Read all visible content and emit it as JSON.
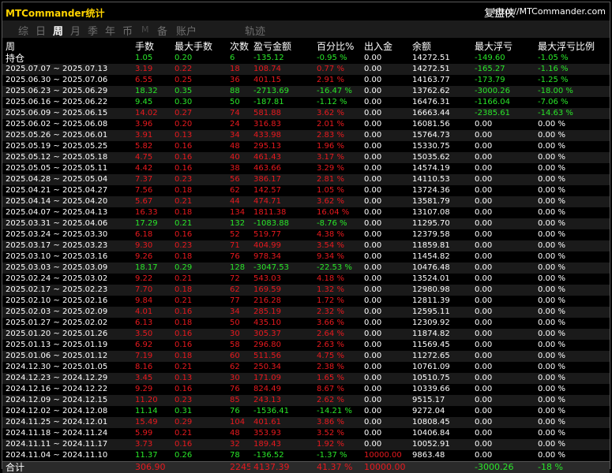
{
  "app": {
    "title": "MTCommander统计",
    "brand_cn": "复盘侠",
    "brand_url": "http://MTCommander.com"
  },
  "tabs": [
    {
      "label": "综",
      "active": false
    },
    {
      "label": "日",
      "active": false
    },
    {
      "label": "周",
      "active": true
    },
    {
      "label": "月",
      "active": false
    },
    {
      "label": "季",
      "active": false
    },
    {
      "label": "年",
      "active": false
    },
    {
      "label": "币",
      "active": false
    },
    {
      "label": "M",
      "active": false
    },
    {
      "label": "备",
      "active": false
    },
    {
      "label": "账户",
      "active": false
    },
    {
      "label": "轨迹",
      "active": false
    }
  ],
  "colors": {
    "profit": "#e8191e",
    "loss": "#29e629",
    "text": "#ffffff",
    "title": "#ffd400"
  },
  "columns": [
    "周",
    "手数",
    "最大手数",
    "次数",
    "盈亏金额",
    "百分比%",
    "出入金",
    "余额",
    "最大浮亏",
    "最大浮亏比例"
  ],
  "holding": {
    "label": "持仓",
    "lots": "1.05",
    "max_lots": "0.20",
    "count": "6",
    "pnl": "-135.12",
    "pct": "-0.95 %",
    "flow": "0.00",
    "balance": "14272.51",
    "max_float": "-149.60",
    "max_float_pct": "-1.05 %"
  },
  "rows": [
    {
      "week": "2025.07.07 ~ 2025.07.13",
      "lots": "3.19",
      "max_lots": "0.22",
      "count": "18",
      "pnl": "108.74",
      "pct": "0.77 %",
      "flow": "0.00",
      "balance": "14272.51",
      "max_float": "-165.27",
      "max_float_pct": "-1.16 %"
    },
    {
      "week": "2025.06.30 ~ 2025.07.06",
      "lots": "6.55",
      "max_lots": "0.25",
      "count": "36",
      "pnl": "401.15",
      "pct": "2.91 %",
      "flow": "0.00",
      "balance": "14163.77",
      "max_float": "-173.79",
      "max_float_pct": "-1.25 %"
    },
    {
      "week": "2025.06.23 ~ 2025.06.29",
      "lots": "18.32",
      "max_lots": "0.35",
      "count": "88",
      "pnl": "-2713.69",
      "pct": "-16.47 %",
      "flow": "0.00",
      "balance": "13762.62",
      "max_float": "-3000.26",
      "max_float_pct": "-18.00 %"
    },
    {
      "week": "2025.06.16 ~ 2025.06.22",
      "lots": "9.45",
      "max_lots": "0.30",
      "count": "50",
      "pnl": "-187.81",
      "pct": "-1.12 %",
      "flow": "0.00",
      "balance": "16476.31",
      "max_float": "-1166.04",
      "max_float_pct": "-7.06 %"
    },
    {
      "week": "2025.06.09 ~ 2025.06.15",
      "lots": "14.02",
      "max_lots": "0.27",
      "count": "74",
      "pnl": "581.88",
      "pct": "3.62 %",
      "flow": "0.00",
      "balance": "16663.44",
      "max_float": "-2385.61",
      "max_float_pct": "-14.63 %"
    },
    {
      "week": "2025.06.02 ~ 2025.06.08",
      "lots": "3.96",
      "max_lots": "0.20",
      "count": "24",
      "pnl": "316.83",
      "pct": "2.01 %",
      "flow": "0.00",
      "balance": "16081.56",
      "max_float": "0.00",
      "max_float_pct": "0.00 %"
    },
    {
      "week": "2025.05.26 ~ 2025.06.01",
      "lots": "3.91",
      "max_lots": "0.13",
      "count": "34",
      "pnl": "433.98",
      "pct": "2.83 %",
      "flow": "0.00",
      "balance": "15764.73",
      "max_float": "0.00",
      "max_float_pct": "0.00 %"
    },
    {
      "week": "2025.05.19 ~ 2025.05.25",
      "lots": "5.82",
      "max_lots": "0.16",
      "count": "48",
      "pnl": "295.13",
      "pct": "1.96 %",
      "flow": "0.00",
      "balance": "15330.75",
      "max_float": "0.00",
      "max_float_pct": "0.00 %"
    },
    {
      "week": "2025.05.12 ~ 2025.05.18",
      "lots": "4.75",
      "max_lots": "0.16",
      "count": "40",
      "pnl": "461.43",
      "pct": "3.17 %",
      "flow": "0.00",
      "balance": "15035.62",
      "max_float": "0.00",
      "max_float_pct": "0.00 %"
    },
    {
      "week": "2025.05.05 ~ 2025.05.11",
      "lots": "4.42",
      "max_lots": "0.16",
      "count": "38",
      "pnl": "463.66",
      "pct": "3.29 %",
      "flow": "0.00",
      "balance": "14574.19",
      "max_float": "0.00",
      "max_float_pct": "0.00 %"
    },
    {
      "week": "2025.04.28 ~ 2025.05.04",
      "lots": "7.37",
      "max_lots": "0.23",
      "count": "56",
      "pnl": "386.17",
      "pct": "2.81 %",
      "flow": "0.00",
      "balance": "14110.53",
      "max_float": "0.00",
      "max_float_pct": "0.00 %"
    },
    {
      "week": "2025.04.21 ~ 2025.04.27",
      "lots": "7.56",
      "max_lots": "0.18",
      "count": "62",
      "pnl": "142.57",
      "pct": "1.05 %",
      "flow": "0.00",
      "balance": "13724.36",
      "max_float": "0.00",
      "max_float_pct": "0.00 %"
    },
    {
      "week": "2025.04.14 ~ 2025.04.20",
      "lots": "5.67",
      "max_lots": "0.21",
      "count": "44",
      "pnl": "474.71",
      "pct": "3.62 %",
      "flow": "0.00",
      "balance": "13581.79",
      "max_float": "0.00",
      "max_float_pct": "0.00 %"
    },
    {
      "week": "2025.04.07 ~ 2025.04.13",
      "lots": "16.33",
      "max_lots": "0.18",
      "count": "134",
      "pnl": "1811.38",
      "pct": "16.04 %",
      "flow": "0.00",
      "balance": "13107.08",
      "max_float": "0.00",
      "max_float_pct": "0.00 %"
    },
    {
      "week": "2025.03.31 ~ 2025.04.06",
      "lots": "17.29",
      "max_lots": "0.21",
      "count": "132",
      "pnl": "-1083.88",
      "pct": "-8.76 %",
      "flow": "0.00",
      "balance": "11295.70",
      "max_float": "0.00",
      "max_float_pct": "0.00 %"
    },
    {
      "week": "2025.03.24 ~ 2025.03.30",
      "lots": "6.18",
      "max_lots": "0.16",
      "count": "52",
      "pnl": "519.77",
      "pct": "4.38 %",
      "flow": "0.00",
      "balance": "12379.58",
      "max_float": "0.00",
      "max_float_pct": "0.00 %"
    },
    {
      "week": "2025.03.17 ~ 2025.03.23",
      "lots": "9.30",
      "max_lots": "0.23",
      "count": "71",
      "pnl": "404.99",
      "pct": "3.54 %",
      "flow": "0.00",
      "balance": "11859.81",
      "max_float": "0.00",
      "max_float_pct": "0.00 %"
    },
    {
      "week": "2025.03.10 ~ 2025.03.16",
      "lots": "9.26",
      "max_lots": "0.18",
      "count": "76",
      "pnl": "978.34",
      "pct": "9.34 %",
      "flow": "0.00",
      "balance": "11454.82",
      "max_float": "0.00",
      "max_float_pct": "0.00 %"
    },
    {
      "week": "2025.03.03 ~ 2025.03.09",
      "lots": "18.17",
      "max_lots": "0.29",
      "count": "128",
      "pnl": "-3047.53",
      "pct": "-22.53 %",
      "flow": "0.00",
      "balance": "10476.48",
      "max_float": "0.00",
      "max_float_pct": "0.00 %"
    },
    {
      "week": "2025.02.24 ~ 2025.03.02",
      "lots": "9.22",
      "max_lots": "0.21",
      "count": "72",
      "pnl": "543.03",
      "pct": "4.18 %",
      "flow": "0.00",
      "balance": "13524.01",
      "max_float": "0.00",
      "max_float_pct": "0.00 %"
    },
    {
      "week": "2025.02.17 ~ 2025.02.23",
      "lots": "7.70",
      "max_lots": "0.18",
      "count": "62",
      "pnl": "169.59",
      "pct": "1.32 %",
      "flow": "0.00",
      "balance": "12980.98",
      "max_float": "0.00",
      "max_float_pct": "0.00 %"
    },
    {
      "week": "2025.02.10 ~ 2025.02.16",
      "lots": "9.84",
      "max_lots": "0.21",
      "count": "77",
      "pnl": "216.28",
      "pct": "1.72 %",
      "flow": "0.00",
      "balance": "12811.39",
      "max_float": "0.00",
      "max_float_pct": "0.00 %"
    },
    {
      "week": "2025.02.03 ~ 2025.02.09",
      "lots": "4.01",
      "max_lots": "0.16",
      "count": "34",
      "pnl": "285.19",
      "pct": "2.32 %",
      "flow": "0.00",
      "balance": "12595.11",
      "max_float": "0.00",
      "max_float_pct": "0.00 %"
    },
    {
      "week": "2025.01.27 ~ 2025.02.02",
      "lots": "6.13",
      "max_lots": "0.18",
      "count": "50",
      "pnl": "435.10",
      "pct": "3.66 %",
      "flow": "0.00",
      "balance": "12309.92",
      "max_float": "0.00",
      "max_float_pct": "0.00 %"
    },
    {
      "week": "2025.01.20 ~ 2025.01.26",
      "lots": "3.50",
      "max_lots": "0.16",
      "count": "30",
      "pnl": "305.37",
      "pct": "2.64 %",
      "flow": "0.00",
      "balance": "11874.82",
      "max_float": "0.00",
      "max_float_pct": "0.00 %"
    },
    {
      "week": "2025.01.13 ~ 2025.01.19",
      "lots": "6.92",
      "max_lots": "0.16",
      "count": "58",
      "pnl": "296.80",
      "pct": "2.63 %",
      "flow": "0.00",
      "balance": "11569.45",
      "max_float": "0.00",
      "max_float_pct": "0.00 %"
    },
    {
      "week": "2025.01.06 ~ 2025.01.12",
      "lots": "7.19",
      "max_lots": "0.18",
      "count": "60",
      "pnl": "511.56",
      "pct": "4.75 %",
      "flow": "0.00",
      "balance": "11272.65",
      "max_float": "0.00",
      "max_float_pct": "0.00 %"
    },
    {
      "week": "2024.12.30 ~ 2025.01.05",
      "lots": "8.16",
      "max_lots": "0.21",
      "count": "62",
      "pnl": "250.34",
      "pct": "2.38 %",
      "flow": "0.00",
      "balance": "10761.09",
      "max_float": "0.00",
      "max_float_pct": "0.00 %"
    },
    {
      "week": "2024.12.23 ~ 2024.12.29",
      "lots": "3.45",
      "max_lots": "0.13",
      "count": "30",
      "pnl": "171.09",
      "pct": "1.65 %",
      "flow": "0.00",
      "balance": "10510.75",
      "max_float": "0.00",
      "max_float_pct": "0.00 %"
    },
    {
      "week": "2024.12.16 ~ 2024.12.22",
      "lots": "9.29",
      "max_lots": "0.16",
      "count": "76",
      "pnl": "824.49",
      "pct": "8.67 %",
      "flow": "0.00",
      "balance": "10339.66",
      "max_float": "0.00",
      "max_float_pct": "0.00 %"
    },
    {
      "week": "2024.12.09 ~ 2024.12.15",
      "lots": "11.20",
      "max_lots": "0.23",
      "count": "85",
      "pnl": "243.13",
      "pct": "2.62 %",
      "flow": "0.00",
      "balance": "9515.17",
      "max_float": "0.00",
      "max_float_pct": "0.00 %"
    },
    {
      "week": "2024.12.02 ~ 2024.12.08",
      "lots": "11.14",
      "max_lots": "0.31",
      "count": "76",
      "pnl": "-1536.41",
      "pct": "-14.21 %",
      "flow": "0.00",
      "balance": "9272.04",
      "max_float": "0.00",
      "max_float_pct": "0.00 %"
    },
    {
      "week": "2024.11.25 ~ 2024.12.01",
      "lots": "15.49",
      "max_lots": "0.29",
      "count": "104",
      "pnl": "401.61",
      "pct": "3.86 %",
      "flow": "0.00",
      "balance": "10808.45",
      "max_float": "0.00",
      "max_float_pct": "0.00 %"
    },
    {
      "week": "2024.11.18 ~ 2024.11.24",
      "lots": "5.99",
      "max_lots": "0.21",
      "count": "48",
      "pnl": "353.93",
      "pct": "3.52 %",
      "flow": "0.00",
      "balance": "10406.84",
      "max_float": "0.00",
      "max_float_pct": "0.00 %"
    },
    {
      "week": "2024.11.11 ~ 2024.11.17",
      "lots": "3.73",
      "max_lots": "0.16",
      "count": "32",
      "pnl": "189.43",
      "pct": "1.92 %",
      "flow": "0.00",
      "balance": "10052.91",
      "max_float": "0.00",
      "max_float_pct": "0.00 %"
    },
    {
      "week": "2024.11.04 ~ 2024.11.10",
      "lots": "11.37",
      "max_lots": "0.26",
      "count": "78",
      "pnl": "-136.52",
      "pct": "-1.37 %",
      "flow": "10000.00",
      "balance": "9863.48",
      "max_float": "0.00",
      "max_float_pct": "0.00 %"
    }
  ],
  "total": {
    "label": "合计",
    "lots": "306.90",
    "max_lots": "",
    "count": "2245",
    "pnl": "4137.39",
    "pct": "41.37 %",
    "flow": "10000.00",
    "balance": "",
    "max_float": "-3000.26",
    "max_float_pct": "-18 %"
  }
}
